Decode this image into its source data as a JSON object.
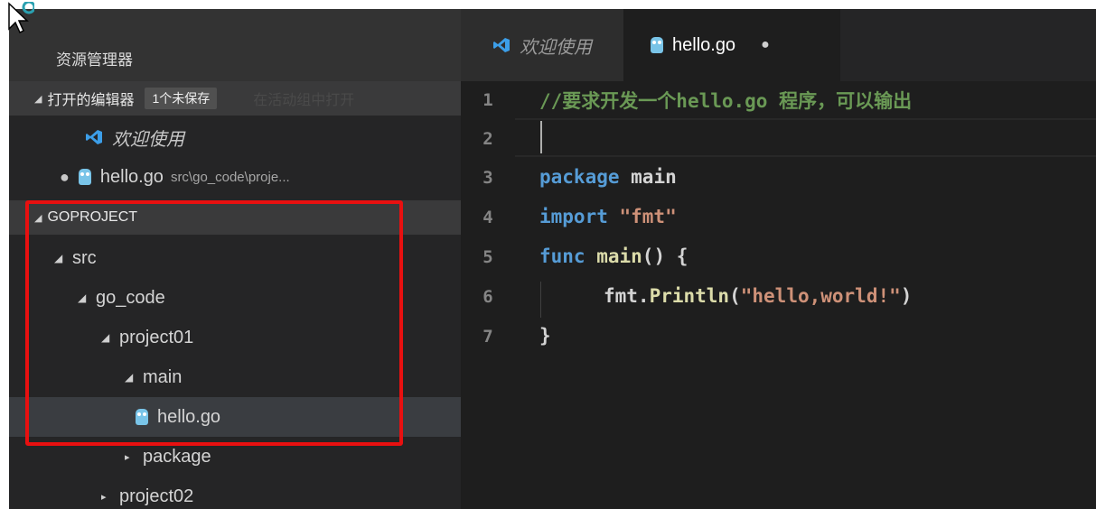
{
  "sidebar": {
    "title": "资源管理器",
    "open_editors": {
      "label": "打开的编辑器",
      "badge": "1个未保存",
      "ghost_text": "在活动组中打开",
      "items": [
        {
          "label": "欢迎使用"
        },
        {
          "label": "hello.go",
          "path": "src\\go_code\\proje..."
        }
      ]
    },
    "project": {
      "label": "GOPROJECT",
      "tree": {
        "src": "src",
        "go_code": "go_code",
        "project01": "project01",
        "main": "main",
        "hello_go": "hello.go",
        "package": "package",
        "project02": "project02"
      }
    }
  },
  "tabs": [
    {
      "label": "欢迎使用"
    },
    {
      "label": "hello.go",
      "dirty_marker": "●"
    }
  ],
  "editor": {
    "line_numbers": [
      "1",
      "2",
      "3",
      "4",
      "5",
      "6",
      "7"
    ],
    "line1_comment_a": "//要求开发一个",
    "line1_comment_b": "hello.go",
    "line1_comment_c": " 程序，可以输出",
    "line3_kw": "package",
    "line3_id": " main",
    "line4_kw": "import",
    "line4_str": " \"fmt\"",
    "line5_kw": "func",
    "line5_fn": " main",
    "line5_rest": "() {",
    "line6_id": "fmt.",
    "line6_fn": "Println",
    "line6_paren_open": "(",
    "line6_str": "\"hello,world!\"",
    "line6_paren_close": ")",
    "line7_text": "}"
  },
  "colors": {
    "highlight_box": "#e81010",
    "comment": "#6a9955",
    "keyword": "#569cd6",
    "string": "#ce9178",
    "function": "#dcdcaa"
  }
}
